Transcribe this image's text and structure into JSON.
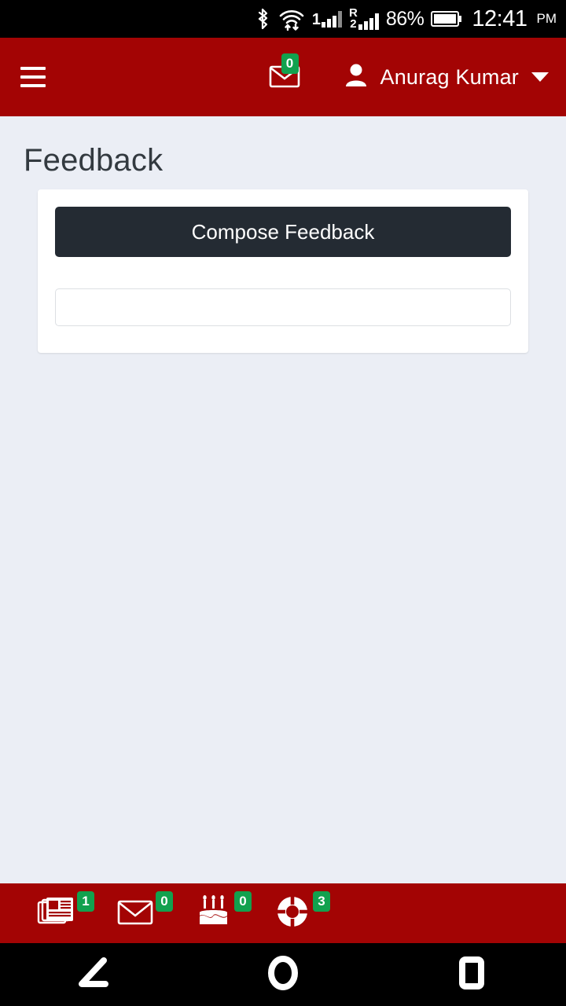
{
  "statusbar": {
    "bluetooth_icon": "bluetooth-icon",
    "wifi_icon": "wifi-icon",
    "sim1_label": "1",
    "roam_letter": "R",
    "sim2_label": "2",
    "battery_percent": "86%",
    "time": "12:41",
    "ampm": "PM"
  },
  "appbar": {
    "menu_icon": "hamburger-menu-icon",
    "mail_icon": "envelope-icon",
    "mail_badge": "0",
    "user_icon": "user-avatar-icon",
    "user_name": "Anurag Kumar",
    "caret_icon": "chevron-down-icon",
    "bg_color": "#a30404"
  },
  "page": {
    "title": "Feedback",
    "bg_color": "#ebeef5"
  },
  "card": {
    "compose_button_label": "Compose Feedback",
    "compose_button_color": "#242b33",
    "input_value": "",
    "input_placeholder": ""
  },
  "bottomnav": {
    "badge_color": "#12a14e",
    "items": [
      {
        "icon": "newspaper-icon",
        "name": "news",
        "badge": "1"
      },
      {
        "icon": "envelope-icon",
        "name": "messages",
        "badge": "0"
      },
      {
        "icon": "birthday-cake-icon",
        "name": "birthdays",
        "badge": "0"
      },
      {
        "icon": "life-ring-icon",
        "name": "support",
        "badge": "3"
      }
    ]
  },
  "androidnav": {
    "back_icon": "back-triangle-icon",
    "home_icon": "home-circle-icon",
    "recents_icon": "recents-square-icon"
  }
}
